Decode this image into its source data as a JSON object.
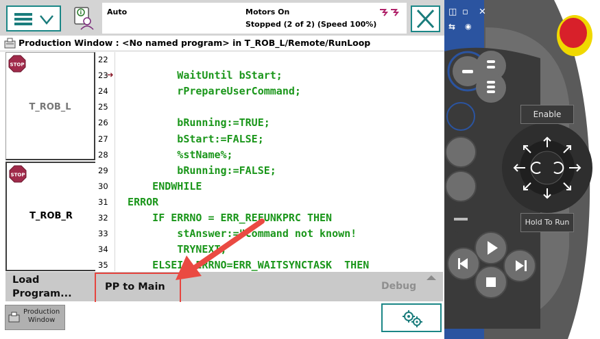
{
  "status": {
    "mode": "Auto",
    "motors": "Motors On",
    "state": "Stopped (2 of 2) (Speed 100%)"
  },
  "title_bar": {
    "text": "Production Window : <No named program> in T_ROB_L/Remote/RunLoop"
  },
  "tasks": [
    {
      "label": "T_ROB_L",
      "stop_label": "STOP"
    },
    {
      "label": "T_ROB_R",
      "stop_label": "STOP"
    }
  ],
  "code": {
    "line_numbers": [
      "22",
      "23",
      "24",
      "25",
      "26",
      "27",
      "28",
      "29",
      "30",
      "31",
      "32",
      "33",
      "34",
      "35"
    ],
    "lines": [
      "",
      "          WaitUntil bStart;",
      "          rPrepareUserCommand;",
      "",
      "          bRunning:=TRUE;",
      "          bStart:=FALSE;",
      "          %stName%;",
      "          bRunning:=FALSE;",
      "      ENDWHILE",
      "  ERROR",
      "      IF ERRNO = ERR_REFUNKPRC THEN",
      "          stAnswer:=\"Command not known!",
      "          TRYNEXT;",
      "      ELSEIF ERRNO=ERR_WAITSYNCTASK  THEN"
    ],
    "program_pointer_line": "23"
  },
  "toolbar": {
    "load_program_line1": "Load",
    "load_program_line2": "Program...",
    "pp_to_main": "PP to Main",
    "debug": "Debug"
  },
  "statusbar": {
    "production_window_line1": "Production",
    "production_window_line2": "Window"
  },
  "pendant": {
    "enable": "Enable",
    "hold_to_run": "Hold To Run"
  },
  "icons": {
    "menu": "hamburger-menu-icon",
    "info": "event-log-info-icon",
    "close": "close-icon",
    "quickset": "gears-icon",
    "program_pointer": "arrow-right-icon"
  },
  "colors": {
    "accent_teal": "#1a8686",
    "code_green": "#1a961a",
    "highlight_red": "#e6443e",
    "pendant_blue": "#2b54a0",
    "emergency_stop_red": "#d8202a",
    "emergency_stop_yellow": "#f0d800"
  }
}
